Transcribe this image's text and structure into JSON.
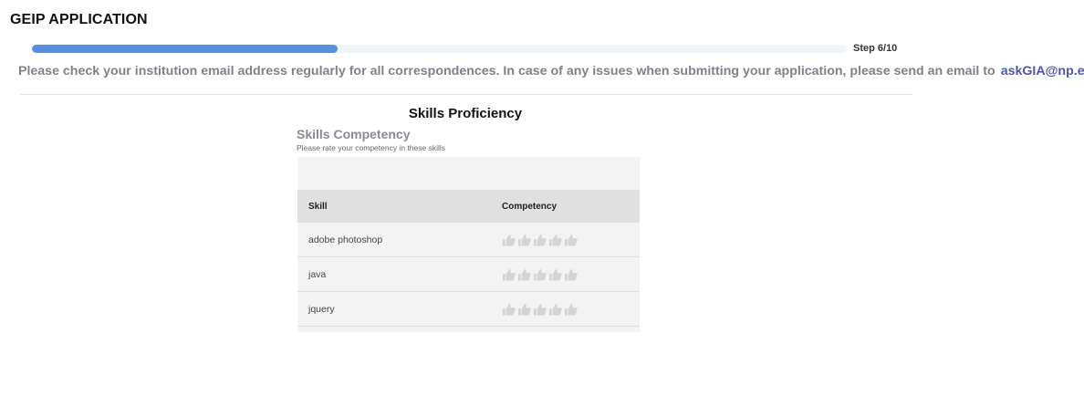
{
  "app": {
    "title": "GEIP APPLICATION"
  },
  "progress": {
    "fraction": 0.375,
    "step_label": "Step 6/10"
  },
  "notice": {
    "text": "Please check your institution email address regularly for all correspondences. In case of any issues when submitting your application, please send an email to",
    "email": "askGIA@np.edu.sg"
  },
  "section": {
    "title": "Skills Proficiency",
    "subtitle": "Skills Competency",
    "description": "Please rate your competency in these skills"
  },
  "table": {
    "headers": {
      "skill": "Skill",
      "competency": "Competency"
    },
    "rows": [
      {
        "skill": "adobe photoshop",
        "rating": 0,
        "max_rating": 5
      },
      {
        "skill": "java",
        "rating": 0,
        "max_rating": 5
      },
      {
        "skill": "jquery",
        "rating": 0,
        "max_rating": 5
      }
    ]
  },
  "colors": {
    "progress_fill": "#5591de",
    "progress_track": "#f1f4f8",
    "email_link": "#4b55a8",
    "thumb_inactive": "#d4d4d4"
  },
  "icons": {
    "rating": "thumbs-up-icon"
  }
}
